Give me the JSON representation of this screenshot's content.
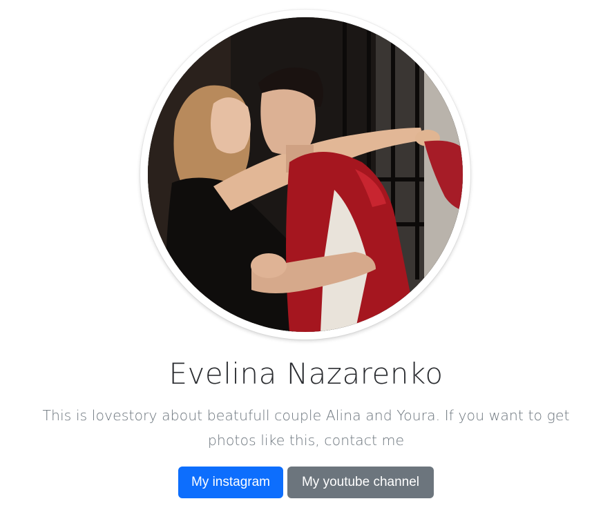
{
  "profile": {
    "name": "Evelina Nazarenko",
    "description": "This is lovestory about beatufull couple Alina and Youra. If you want to get photos like this, contact me",
    "photo_icon": "couple-photo"
  },
  "actions": {
    "instagram_label": "My instagram",
    "youtube_label": "My youtube channel"
  },
  "colors": {
    "primary": "#0d6efd",
    "secondary": "#6c757d",
    "heading": "#2b2d31",
    "muted": "#6c757d"
  }
}
